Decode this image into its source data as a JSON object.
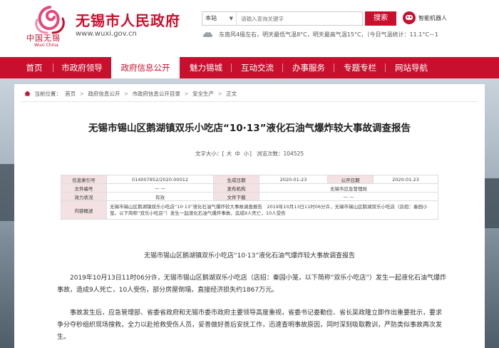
{
  "header": {
    "logo_text": "中国无锡",
    "logo_sub": "Wuxi China",
    "site_title": "无锡市人民政府",
    "site_url": "www.wuxi.gov.cn",
    "search": {
      "scope_label": "本站",
      "placeholder": "请输入查询关键字",
      "button_label": "搜索"
    },
    "robot_label": "智能机器人",
    "weather_text": "东南风4级左右，明天最低气温8°C，明天最高气温15°C，（今日气温统计：11.1°C－1"
  },
  "nav": {
    "items": [
      {
        "label": "首页"
      },
      {
        "label": "市政府领导"
      },
      {
        "label": "政府信息公开"
      },
      {
        "label": "魅力锡城"
      },
      {
        "label": "互动交流"
      },
      {
        "label": "办事服务"
      },
      {
        "label": "专题专栏"
      },
      {
        "label": "网站导航"
      }
    ],
    "active_index": 2
  },
  "breadcrumb": {
    "prefix": "当前位置：",
    "items": [
      "首页",
      "政府信息公开",
      "市政府信息公开目录",
      "安全生产",
      "正文"
    ],
    "sep": ">"
  },
  "article": {
    "title": "无锡市锡山区鹅湖镇双乐小吃店“10·13”液化石油气爆炸较大事故调查报告",
    "font_size_label": "文字大小：",
    "font_size_big": "大",
    "font_size_mid": "中",
    "font_size_small": "小",
    "views_label": "浏览次数：",
    "views_count": "104525",
    "heading": "无锡市锡山区鹅湖镇双乐小吃店“10·13”液化石油气爆炸较大事故调查报告",
    "paragraphs": [
      "2019年10月13日11时06分许，无锡市锡山区鹅湖双乐小吃店（店招：秦园小笼，以下简称“双乐小吃店”）发生一起液化石油气爆炸事故，造成9人死亡，10人受伤，部分房屋倒塌，直接经济损失约1867万元。",
      "事故发生后，应急管理部、省委省政府和无锡市委市政府主要领导高度重视，省委书记娄勤俭、省长吴政隆立即作出重要批示，要求争分夺秒组织现场搜救，全力以赴抢救受伤人员，妥善做好善后安抚工作，迅速查明事故原因，同时深刻吸取教训，严防类似事故再次发生。"
    ]
  },
  "meta": {
    "index_label": "信息索引号",
    "index_value": "014007852/2020-00012",
    "gen_date_label": "生成日期",
    "gen_date_value": "2020-01-23",
    "pub_date_label": "公开日期",
    "pub_date_value": "2020-01-23",
    "doc_no_label": "文件编号",
    "doc_no_value": "— —",
    "org_label": "发布机构",
    "org_value": "无锡市应急管理局",
    "validity_label": "效力状况",
    "validity_value": "有效",
    "effective_label": "文件下载",
    "effective_value": "— —",
    "summary_label": "内容概述",
    "summary_value": "无锡市锡山区鹅湖镇双乐小吃店“10·13”液化石油气爆炸较大事故调查报告　2019年10月13日11时06分许，无锡市锡山区鹅湖双乐小吃店（店招：秦园小笼，以下简称“双乐小吃店”）发生一起液化石油气爆炸事故，造成9人死亡，10人受伤"
  },
  "colors": {
    "brand": "#c8102e",
    "label_bg": "#f3e1e3"
  },
  "icons": {
    "home": "home-icon",
    "weather": "cloudy-icon",
    "robot": "robot-icon"
  }
}
